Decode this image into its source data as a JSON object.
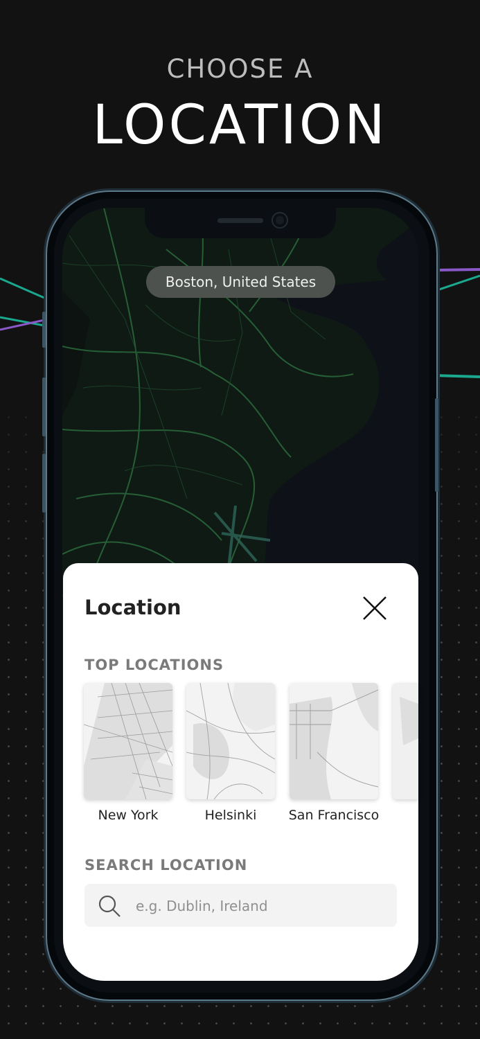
{
  "headline": {
    "small": "CHOOSE A",
    "big": "LOCATION"
  },
  "map": {
    "current_location": "Boston, United States"
  },
  "sheet": {
    "title": "Location",
    "top_locations_label": "TOP LOCATIONS",
    "locations": [
      {
        "name": "New York"
      },
      {
        "name": "Helsinki"
      },
      {
        "name": "San Francisco"
      }
    ],
    "search_label": "SEARCH LOCATION",
    "search_placeholder": "e.g. Dublin, Ireland"
  },
  "colors": {
    "background": "#121212",
    "map_green": "#1f5a36",
    "accent_teal": "#1aa88e",
    "accent_purple": "#8a58c9"
  },
  "icons": [
    "close-icon",
    "search-icon"
  ]
}
